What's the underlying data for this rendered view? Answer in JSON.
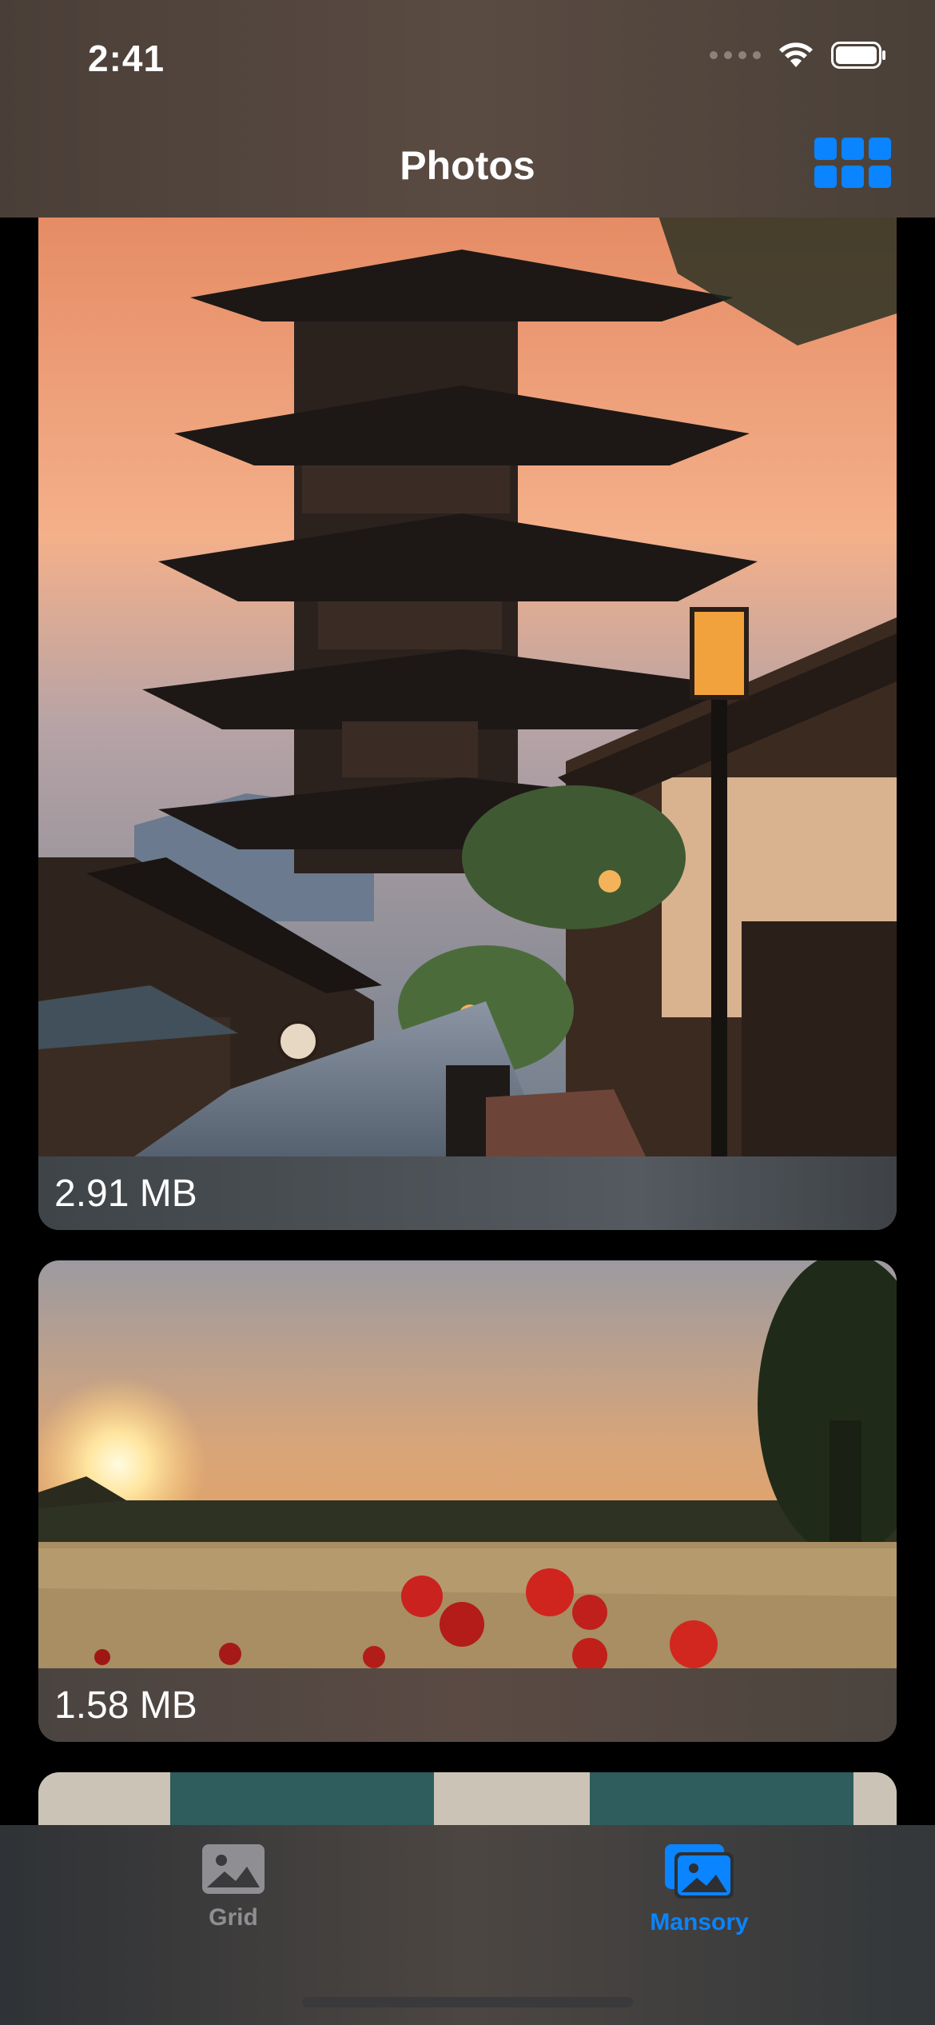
{
  "status_bar": {
    "time": "2:41"
  },
  "nav": {
    "title": "Photos",
    "layout_icon": "grid-layout-icon"
  },
  "photos": [
    {
      "size": "2.91 MB",
      "subject": "pagoda-at-sunset"
    },
    {
      "size": "1.58 MB",
      "subject": "poppy-field-sunset"
    },
    {
      "size": "",
      "subject": "partial-photo"
    }
  ],
  "tabs": [
    {
      "label": "Grid",
      "icon": "photo-icon",
      "selected": false
    },
    {
      "label": "Mansory",
      "icon": "photo-stack-icon",
      "selected": true
    }
  ],
  "colors": {
    "accent": "#0a84ff",
    "inactive": "#8e8e93"
  }
}
